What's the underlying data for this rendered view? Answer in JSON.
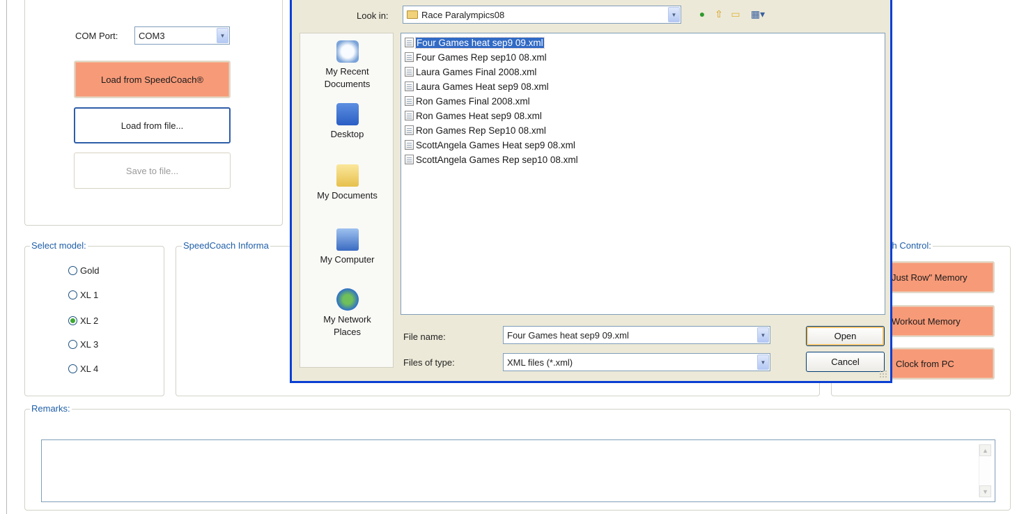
{
  "com_port": {
    "label": "COM Port:",
    "value": "COM3"
  },
  "buttons": {
    "load_speedcoach": "Load from SpeedCoach®",
    "load_file": "Load from file...",
    "save_file": "Save to file..."
  },
  "select_model": {
    "legend": "Select model:",
    "options": [
      {
        "label": "Gold",
        "checked": false
      },
      {
        "label": "XL 1",
        "checked": false
      },
      {
        "label": "XL 2",
        "checked": true
      },
      {
        "label": "XL 3",
        "checked": false
      },
      {
        "label": "XL 4",
        "checked": false
      }
    ]
  },
  "speedcoach_info": {
    "legend": "SpeedCoach Informa"
  },
  "control": {
    "legend": "ch Control:",
    "buttons": [
      "Just Row\" Memory",
      "Workout Memory",
      "Clock from PC"
    ]
  },
  "remarks": {
    "legend": "Remarks:",
    "value": ""
  },
  "dialog": {
    "look_in_label": "Look in:",
    "look_in_value": "Race Paralympics08",
    "places": [
      "My Recent Documents",
      "Desktop",
      "My Documents",
      "My Computer",
      "My Network Places"
    ],
    "files": [
      "Four Games heat sep9 09.xml",
      "Four Games Rep sep10 08.xml",
      "Laura Games Final 2008.xml",
      "Laura Games Heat sep9 08.xml",
      "Ron Games Final 2008.xml",
      "Ron Games Heat sep9 08.xml",
      "Ron Games Rep Sep10 08.xml",
      "ScottAngela Games Heat sep9 08.xml",
      "ScottAngela Games Rep sep10 08.xml"
    ],
    "selected_file": "Four Games heat sep9 09.xml",
    "file_name_label": "File name:",
    "file_name_value": "Four Games heat sep9 09.xml",
    "file_type_label": "Files of type:",
    "file_type_value": "XML files (*.xml)",
    "open_label": "Open",
    "cancel_label": "Cancel"
  },
  "colors": {
    "accent_orange": "#f79a78",
    "dialog_frame": "#0a3fd3",
    "legend_blue": "#1f5fa8"
  }
}
